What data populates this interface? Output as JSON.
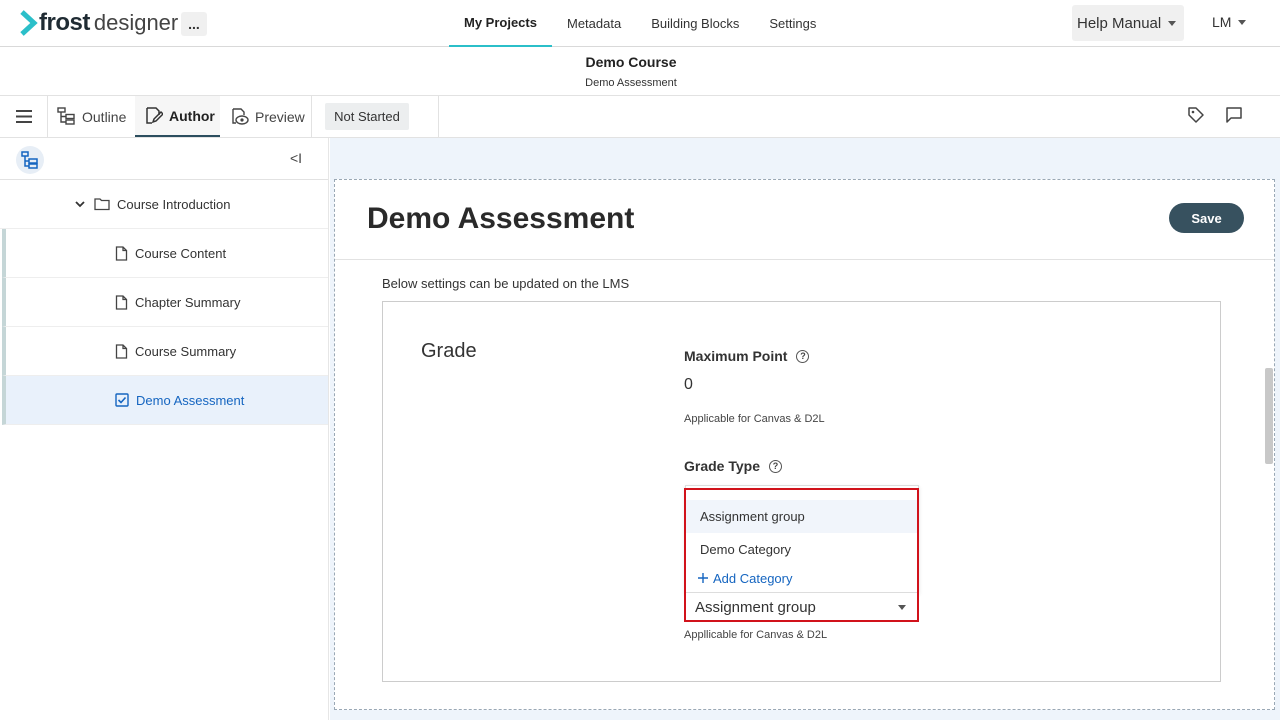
{
  "app": {
    "logo_brand": "frost",
    "logo_product": "designer",
    "more": "..."
  },
  "nav": {
    "tabs": [
      {
        "label": "My Projects",
        "active": true
      },
      {
        "label": "Metadata"
      },
      {
        "label": "Building Blocks"
      },
      {
        "label": "Settings"
      }
    ],
    "help": "Help Manual",
    "user": "LM"
  },
  "course": {
    "title": "Demo Course",
    "subtitle": "Demo Assessment"
  },
  "toolbar": {
    "outline": "Outline",
    "author": "Author",
    "preview": "Preview",
    "status": "Not Started"
  },
  "sidebar": {
    "collapse": "<I",
    "folder": "Course Introduction",
    "items": [
      {
        "label": "Course Content"
      },
      {
        "label": "Chapter Summary"
      },
      {
        "label": "Course Summary"
      },
      {
        "label": "Demo Assessment",
        "selected": true
      }
    ]
  },
  "main": {
    "title": "Demo Assessment",
    "save": "Save",
    "lms_note": "Below settings can be updated on the LMS",
    "section": "Grade",
    "max_point_label": "Maximum Point",
    "max_point_value": "0",
    "max_point_hint": "Applicable for Canvas & D2L",
    "grade_type_label": "Grade Type",
    "grade_type_value": "Assignment group",
    "grade_type_hint": "Appllicable for Canvas & D2L",
    "dropdown_options": [
      "Assignment group",
      "Demo Category"
    ],
    "add_category": "Add Category"
  },
  "colors": {
    "accent": "#2bbfc9",
    "save_bg": "#37515f",
    "link": "#1565c0",
    "highlight": "#d1121b"
  }
}
